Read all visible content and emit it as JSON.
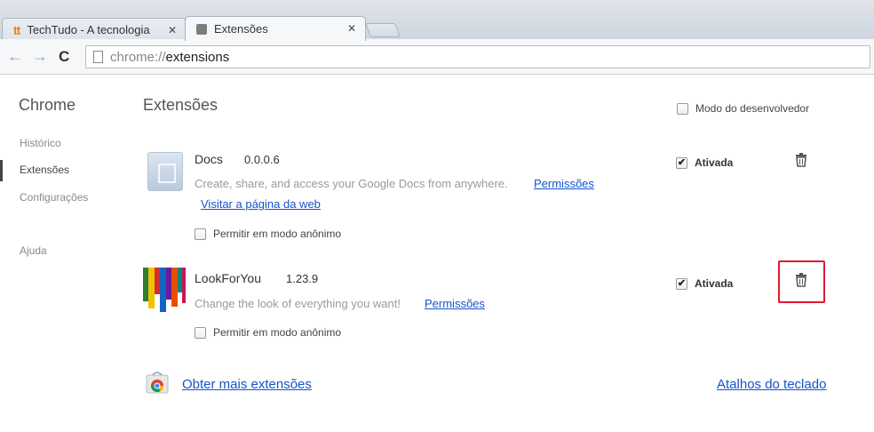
{
  "tabs": [
    {
      "title": "TechTudo - A tecnologia",
      "icon": "techtudo-logo-icon",
      "logo_text": "tt",
      "active": false
    },
    {
      "title": "Extensões",
      "icon": "puzzle-icon",
      "active": true
    }
  ],
  "toolbar": {
    "url_scheme": "chrome://",
    "url_host": "extensions"
  },
  "sidebar": {
    "title": "Chrome",
    "items": [
      {
        "label": "Histórico",
        "selected": false
      },
      {
        "label": "Extensões",
        "selected": true
      },
      {
        "label": "Configurações",
        "selected": false
      },
      {
        "label": "Ajuda",
        "selected": false
      }
    ]
  },
  "main": {
    "title": "Extensões",
    "developer_mode_label": "Modo do desenvolvedor",
    "developer_mode_checked": false
  },
  "extensions": [
    {
      "name": "Docs",
      "version": "0.0.0.6",
      "description": "Create, share, and access your Google Docs from anywhere.",
      "permissions_label": "Permissões",
      "website_label": "Visitar a página da web",
      "incognito_label": "Permitir em modo anônimo",
      "incognito_checked": false,
      "enabled_label": "Ativada",
      "enabled_checked": true
    },
    {
      "name": "LookForYou",
      "version": "1.23.9",
      "description": "Change the look of everything you want!",
      "permissions_label": "Permissões",
      "incognito_label": "Permitir em modo anônimo",
      "incognito_checked": false,
      "enabled_label": "Ativada",
      "enabled_checked": true
    }
  ],
  "footer": {
    "get_more_label": "Obter mais extensões",
    "shortcuts_label": "Atalhos do teclado"
  },
  "colors": {
    "link": "#1155cc",
    "highlight": "#e0192f",
    "techtudo_orange": "#e8811a"
  }
}
